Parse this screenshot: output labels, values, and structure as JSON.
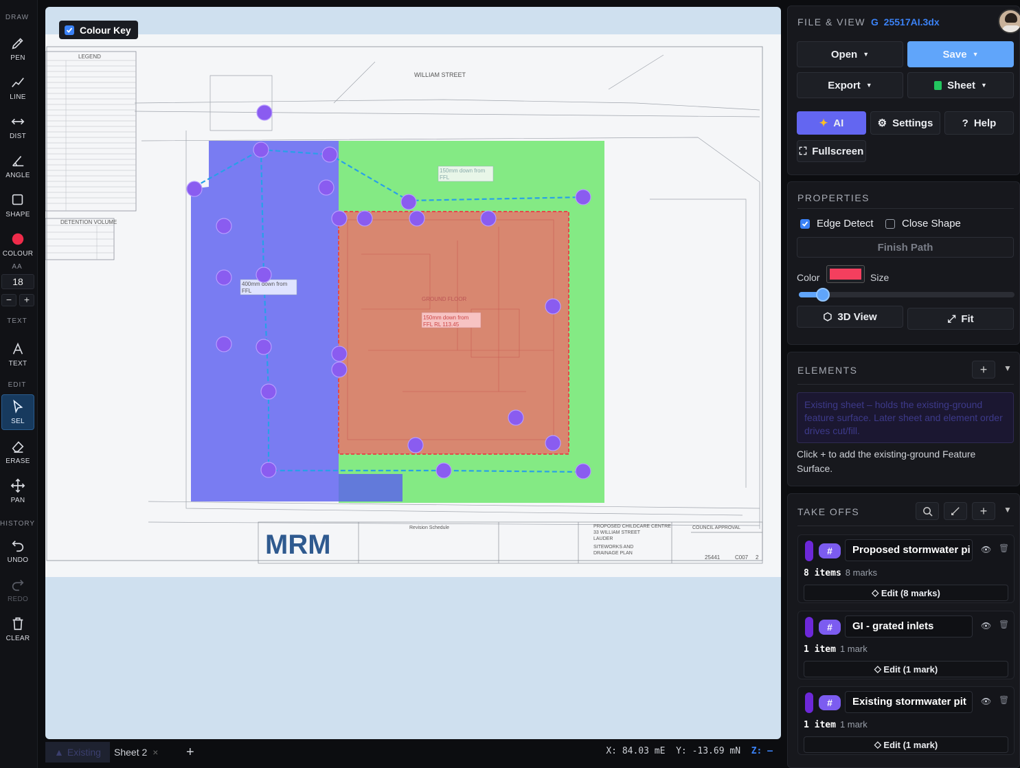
{
  "toolbar": {
    "sections": {
      "draw": "DRAW",
      "aa": "AA",
      "text": "TEXT",
      "edit": "EDIT",
      "history": "HISTORY"
    },
    "tools": {
      "pen": "PEN",
      "line": "LINE",
      "dist": "DIST",
      "angle": "ANGLE",
      "shape": "SHAPE",
      "colour": "COLOUR",
      "text": "TEXT",
      "sel": "SEL",
      "erase": "ERASE",
      "pan": "PAN",
      "undo": "UNDO",
      "redo": "REDO",
      "clear": "CLEAR"
    },
    "active_tool": "SEL",
    "colour_value": "#ef2b4a",
    "aa_value": "18",
    "minus": "−",
    "plus": "+"
  },
  "canvas": {
    "colour_key_label": "Colour Key",
    "colour_key_checked": true,
    "drawing": {
      "street": "WILLIAM    STREET",
      "legend_title": "LEGEND",
      "detention_title": "DETENTION VOLUME",
      "note_blue": [
        "400mm down from",
        "FFL"
      ],
      "note_green": [
        "150mm down from",
        "FFL"
      ],
      "note_red": [
        "150mm down from",
        "FFL  RL 113.45"
      ],
      "ground_floor": "GROUND FLOOR",
      "project_title": [
        "PROPOSED CHILDCARE CENTRE",
        "33 WILLIAM STREET",
        "LAUDER"
      ],
      "drawing_title": [
        "SITEWORKS AND",
        "DRAINAGE PLAN"
      ],
      "council": "COUNCIL APPROVAL",
      "revision_schedule": "Revision Schedule",
      "job_no": "25441",
      "dwg_no": "C007",
      "rev": "2",
      "logo": "MRM"
    }
  },
  "bottombar": {
    "tabs": [
      {
        "label": "Existing",
        "active": true
      },
      {
        "label": "Sheet 2",
        "close": "×"
      }
    ],
    "add": "+",
    "x_label": "X:",
    "x_value": "84.03 mE",
    "y_label": "Y:",
    "y_value": "-13.69 mN",
    "z_label": "Z:",
    "z_value": "—"
  },
  "file_view": {
    "title": "FILE & VIEW",
    "file_prefix": "G",
    "file_name": "25517AI.3dx",
    "open": "Open",
    "save": "Save",
    "export": "Export",
    "sheet": "Sheet",
    "ai": "AI",
    "settings": "Settings",
    "help": "Help",
    "fullscreen": "Fullscreen"
  },
  "properties": {
    "title": "PROPERTIES",
    "edge_detect": "Edge Detect",
    "edge_detect_checked": true,
    "close_shape": "Close Shape",
    "close_shape_checked": false,
    "finish_path": "Finish Path",
    "color_label": "Color",
    "color_value": "#f43f5e",
    "size_label": "Size",
    "size_fraction": 0.11,
    "view3d": "3D View",
    "fit": "Fit"
  },
  "elements": {
    "title": "ELEMENTS",
    "hint": "Existing sheet – holds the existing-ground feature surface. Later sheet and element order drives cut/fill.",
    "empty": "Click + to add the existing-ground Feature Surface."
  },
  "takeoffs": {
    "title": "TAKE OFFS",
    "items": [
      {
        "name": "Proposed stormwater pi",
        "count": "8 items",
        "marks": "8 marks",
        "edit": "Edit (8 marks)"
      },
      {
        "name": "GI - grated inlets",
        "count": "1 item",
        "marks": "1 mark",
        "edit": "Edit (1 mark)"
      },
      {
        "name": "Existing stormwater pit",
        "count": "1 item",
        "marks": "1 mark",
        "edit": "Edit (1 mark)"
      }
    ]
  }
}
